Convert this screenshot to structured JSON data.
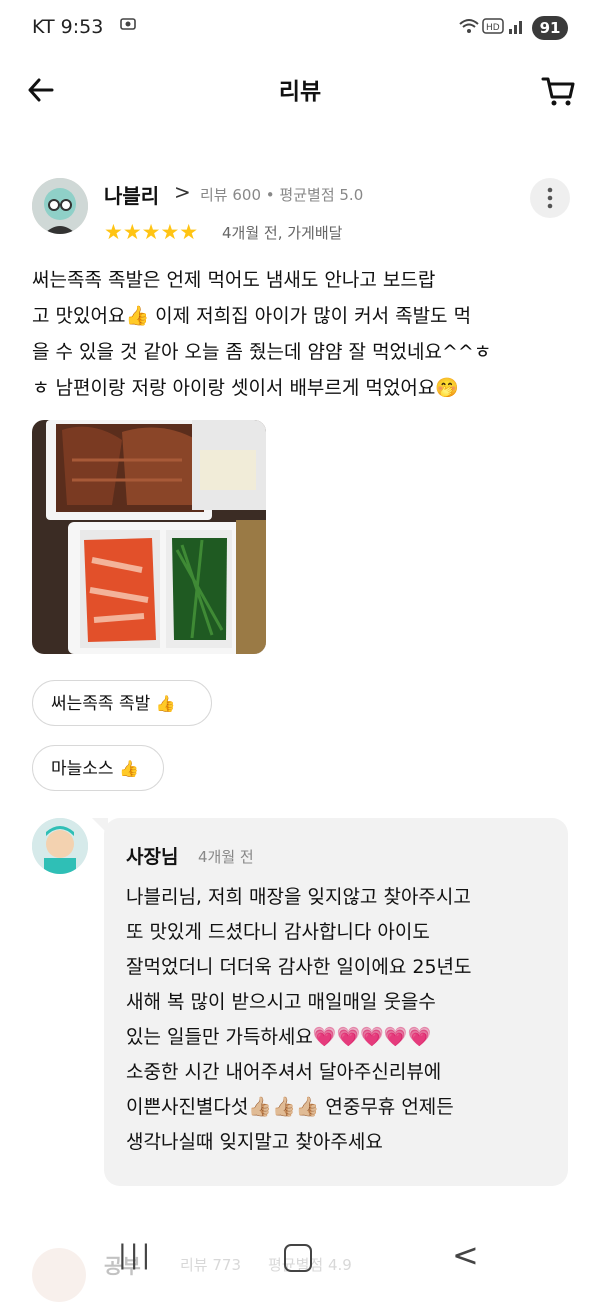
{
  "status_bar": {
    "carrier_time": "KT 9:53",
    "battery": "91"
  },
  "header": {
    "title": "리뷰",
    "back_icon": "arrow-left-icon",
    "cart_icon": "cart-icon"
  },
  "review": {
    "user_name": "나블리",
    "chevron": ">",
    "review_count": "리뷰 600",
    "separator": "•",
    "avg_rating": "평균별점 5.0",
    "stars": "★★★★★",
    "rating": 5,
    "date": "4개월 전, 가게배달",
    "lines": [
      "써는족족 족발은 언제 먹어도 냄새도 안나고 보드랍",
      "고 맛있어요👍 이제 저희집 아이가 많이 커서 족발도 먹",
      "을 수 있을 것 같아 오늘 좀 줬는데 얌얌 잘 먹었네요^^ㅎ",
      "ㅎ 남편이랑 저랑 아이랑 셋이서 배부르게 먹었어요🤭"
    ],
    "tags": [
      "써는족족  족발",
      "마늘소스"
    ],
    "star_color": "#ffc414",
    "accent_color": "#1ec4be"
  },
  "owner_reply": {
    "name": "사장님",
    "date": "4개월 전",
    "lines": [
      "나블리님, 저희 매장을 잊지않고 찾아주시고",
      "또 맛있게 드셨다니 감사합니다 아이도",
      "잘먹었더니 더더욱 감사한 일이에요 25년도",
      "새해 복 많이 받으시고 매일매일 웃을수",
      "있는 일들만 가득하세요💗💗💗💗💗",
      "소중한 시간 내어주셔서 달아주신리뷰에",
      "이쁜사진별다섯👍🏼👍🏼👍🏼 연중무휴 언제든",
      "생각나실때 잊지말고 찾아주세요"
    ]
  },
  "next_review": {
    "user_name": "공부",
    "review_count": "리뷰 773",
    "avg_rating": "평균별점 4.9"
  },
  "nav_bar": {
    "recent": "|||",
    "back": "<"
  }
}
